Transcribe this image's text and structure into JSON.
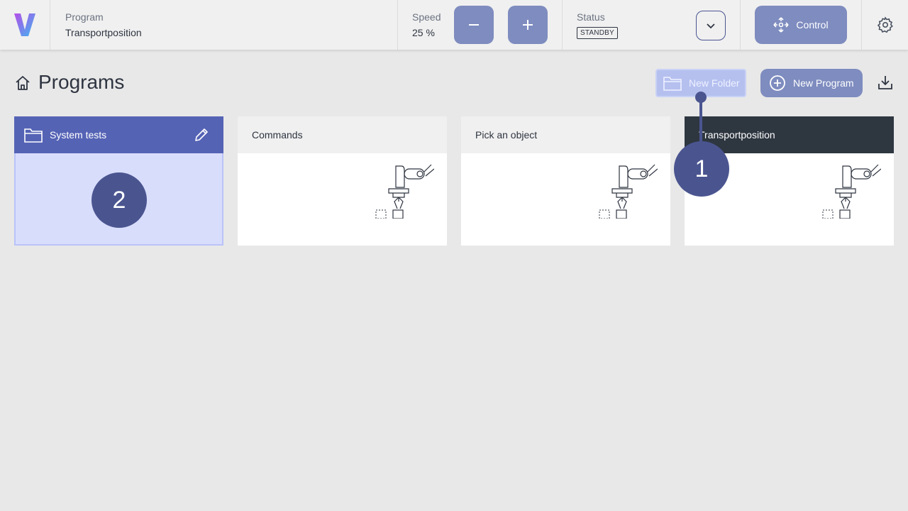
{
  "topbar": {
    "program_label": "Program",
    "program_value": "Transportposition",
    "speed_label": "Speed",
    "speed_value": "25 %",
    "status_label": "Status",
    "status_value": "STANDBY",
    "control_label": "Control"
  },
  "page": {
    "title": "Programs",
    "new_folder_label": "New Folder",
    "new_program_label": "New Program"
  },
  "cards": [
    {
      "title": "System tests",
      "kind": "folder"
    },
    {
      "title": "Commands",
      "kind": "program"
    },
    {
      "title": "Pick an object",
      "kind": "program"
    },
    {
      "title": "Transportposition",
      "kind": "program-active"
    }
  ],
  "markers": {
    "one": "1",
    "two": "2"
  },
  "colors": {
    "accent": "#7e8cbf",
    "primary_dark": "#4a5590",
    "folder_header": "#5563b5",
    "active_card_header": "#2e3640"
  },
  "icons": [
    "logo-v-icon",
    "minus-icon",
    "plus-icon",
    "chevron-down-icon",
    "move-icon",
    "gear-icon",
    "home-icon",
    "folder-icon",
    "plus-circle-icon",
    "download-icon",
    "pencil-icon",
    "robot-arm-icon"
  ]
}
